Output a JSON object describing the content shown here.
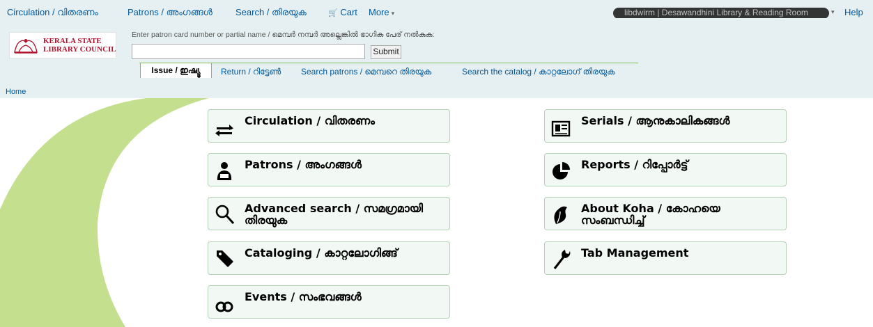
{
  "topbar": {
    "nav": [
      {
        "label": "Circulation / വിതരണം",
        "has_caret": false
      },
      {
        "label": "Patrons / അംഗങ്ങൾ",
        "has_caret": false
      },
      {
        "label": "Search / തിരയുക",
        "has_caret": false
      },
      {
        "label": "Cart",
        "has_caret": false
      },
      {
        "label": "More",
        "has_caret": true
      }
    ],
    "user": "libdwirm | Desawandhini Library & Reading Room",
    "help": "Help"
  },
  "logo": {
    "text_line1": "KERALA STATE",
    "text_line2": "LIBRARY COUNCIL"
  },
  "checkout_search": {
    "label": "Enter patron card number or partial name / മെമ്പർ നമ്പർ അല്ലെങ്കിൽ ഭാഗിക പേര് നൽകുക:",
    "value": "",
    "submit": "Submit"
  },
  "tabs": [
    {
      "label": "Issue / ഇഷ്യൂ",
      "active": true
    },
    {
      "label": "Return / റിട്ടേൺ",
      "active": false
    },
    {
      "label": "Search patrons / മെമ്പറെ തിരയുക",
      "active": false
    },
    {
      "label": "Search the catalog / കാറ്റലോഗ് തിരയുക",
      "active": false
    }
  ],
  "breadcrumb": {
    "home": "Home"
  },
  "modules": {
    "left": [
      {
        "label": "Circulation / വിതരണം",
        "icon": "circulation-icon"
      },
      {
        "label": "Patrons / അംഗങ്ങൾ",
        "icon": "patrons-icon"
      },
      {
        "label": "Advanced search / സമഗ്രമായി തിരയുക",
        "icon": "search-icon"
      },
      {
        "label": "Cataloging / കാറ്റലോഗിങ്ങ്",
        "icon": "tag-icon"
      },
      {
        "label": "Events / സംഭവങ്ങൾ",
        "icon": "link-icon"
      }
    ],
    "right": [
      {
        "label": "Serials / ആനുകാലികങ്ങൾ",
        "icon": "newspaper-icon"
      },
      {
        "label": "Reports / റിപ്പോർട്ട്",
        "icon": "pie-chart-icon"
      },
      {
        "label": "About Koha / കോഹയെ സംബന്ധിച്ച്",
        "icon": "koha-leaf-icon"
      },
      {
        "label": "Tab Management",
        "icon": "wrench-icon"
      }
    ]
  },
  "colors": {
    "topbar_bg": "#e6f0f2",
    "link": "#00589a",
    "tile_bg": "#f2f8f4",
    "tile_border": "#b5d3b7",
    "deco_green": "#c4e08f"
  }
}
